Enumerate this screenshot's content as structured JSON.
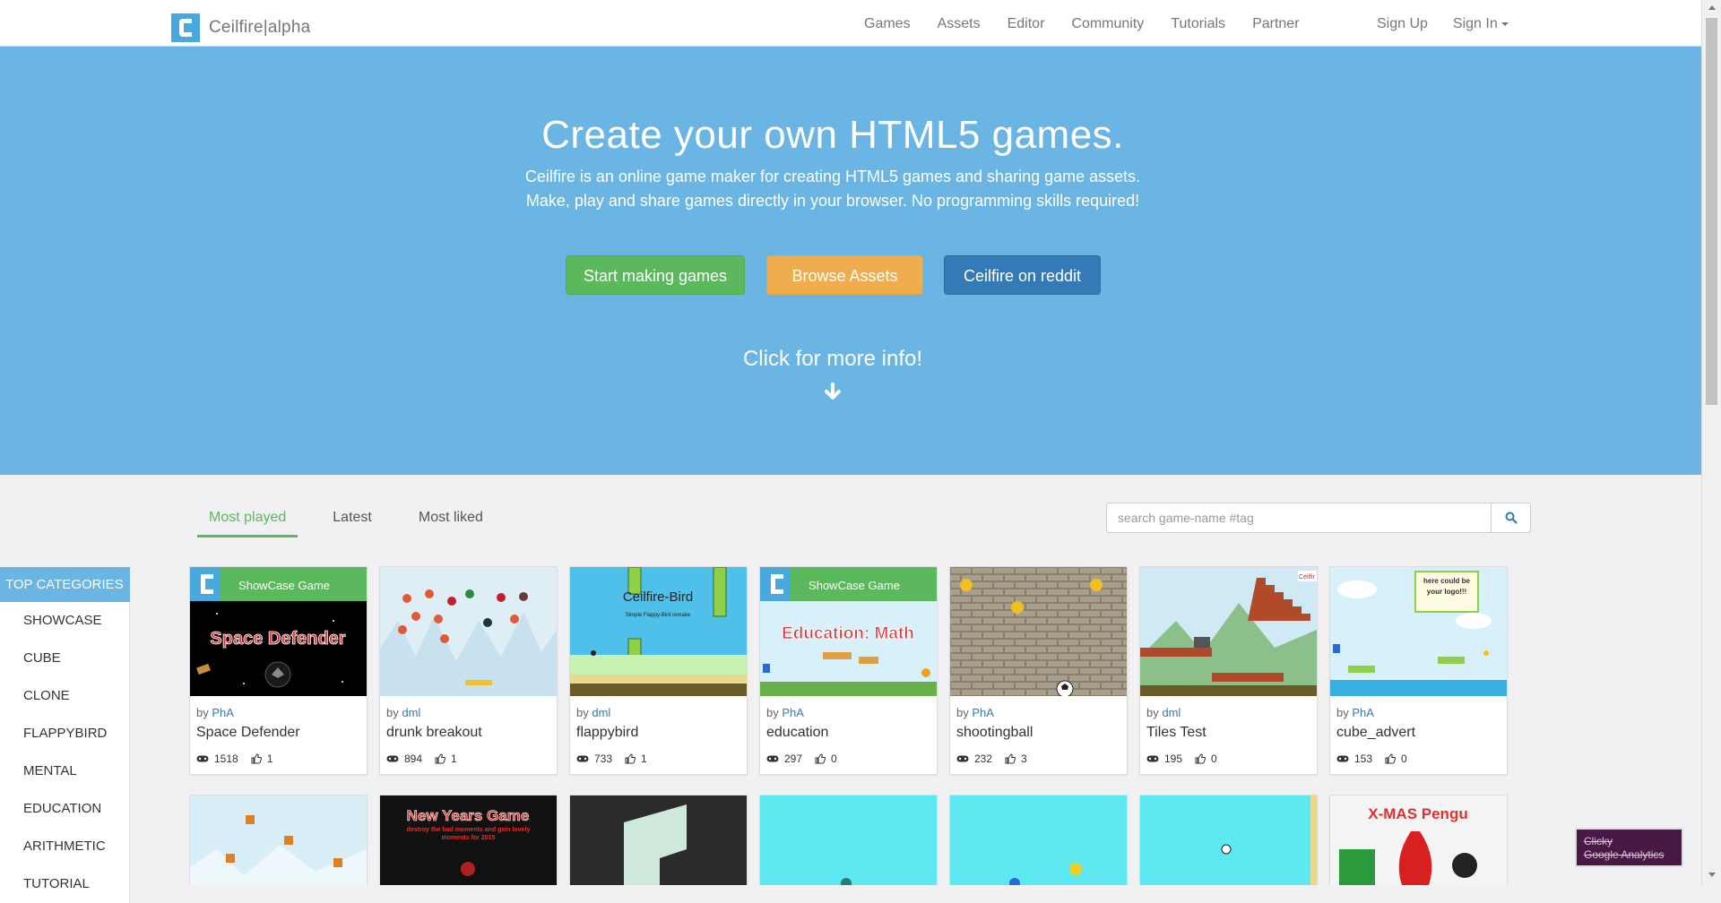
{
  "nav": {
    "brand": "Ceilfire|alpha",
    "links": [
      "Games",
      "Assets",
      "Editor",
      "Community",
      "Tutorials",
      "Partner"
    ],
    "sign_up": "Sign Up",
    "sign_in": "Sign In"
  },
  "hero": {
    "title": "Create your own HTML5 games.",
    "line1": "Ceilfire is an online game maker for creating HTML5 games and sharing game assets.",
    "line2": "Make, play and share games directly in your browser. No programming skills required!",
    "btn_start": "Start making games",
    "btn_browse": "Browse Assets",
    "btn_reddit": "Ceilfire on reddit",
    "more_info": "Click for more info!"
  },
  "tabs": [
    "Most played",
    "Latest",
    "Most liked"
  ],
  "search": {
    "placeholder": "search game-name #tag"
  },
  "sidebar": {
    "heading": "TOP CATEGORIES",
    "items": [
      "SHOWCASE",
      "CUBE",
      "CLONE",
      "FLAPPYBIRD",
      "MENTAL",
      "EDUCATION",
      "ARITHMETIC",
      "TUTORIAL"
    ]
  },
  "games": [
    {
      "by": "by",
      "author": "PhA",
      "title": "Space Defender",
      "plays": "1518",
      "likes": "1",
      "thumb_text": "Space Defender",
      "banner": "ShowCase Game"
    },
    {
      "by": "by",
      "author": "dml",
      "title": "drunk breakout",
      "plays": "894",
      "likes": "1"
    },
    {
      "by": "by",
      "author": "dml",
      "title": "flappybird",
      "plays": "733",
      "likes": "1",
      "thumb_text": "Ceilfire-Bird",
      "thumb_sub": "Simple Flappy-Bird remake"
    },
    {
      "by": "by",
      "author": "PhA",
      "title": "education",
      "plays": "297",
      "likes": "0",
      "thumb_text": "Education: Math",
      "banner": "ShowCase Game"
    },
    {
      "by": "by",
      "author": "PhA",
      "title": "shootingball",
      "plays": "232",
      "likes": "3"
    },
    {
      "by": "by",
      "author": "dml",
      "title": "Tiles Test",
      "plays": "195",
      "likes": "0",
      "thumb_corner": "Ceilfir"
    },
    {
      "by": "by",
      "author": "PhA",
      "title": "cube_advert",
      "plays": "153",
      "likes": "0",
      "thumb_text": "here could be your logo!!!"
    }
  ],
  "row2": [
    {
      "thumb_text": ""
    },
    {
      "thumb_text": "New Years Game",
      "thumb_sub": "destroy the bad moments and gain lovely moments for 2015"
    },
    {
      "thumb_text": ""
    },
    {
      "thumb_text": ""
    },
    {
      "thumb_text": ""
    },
    {
      "thumb_text": ""
    },
    {
      "thumb_text": "X-MAS Pengu"
    }
  ],
  "badge": {
    "line1": "Clicky",
    "line2": "Google Analytics"
  },
  "colors": {
    "hero": "#6ab5e3",
    "green": "#5cb85c",
    "orange": "#f0ad4e",
    "blue": "#337ab7"
  }
}
